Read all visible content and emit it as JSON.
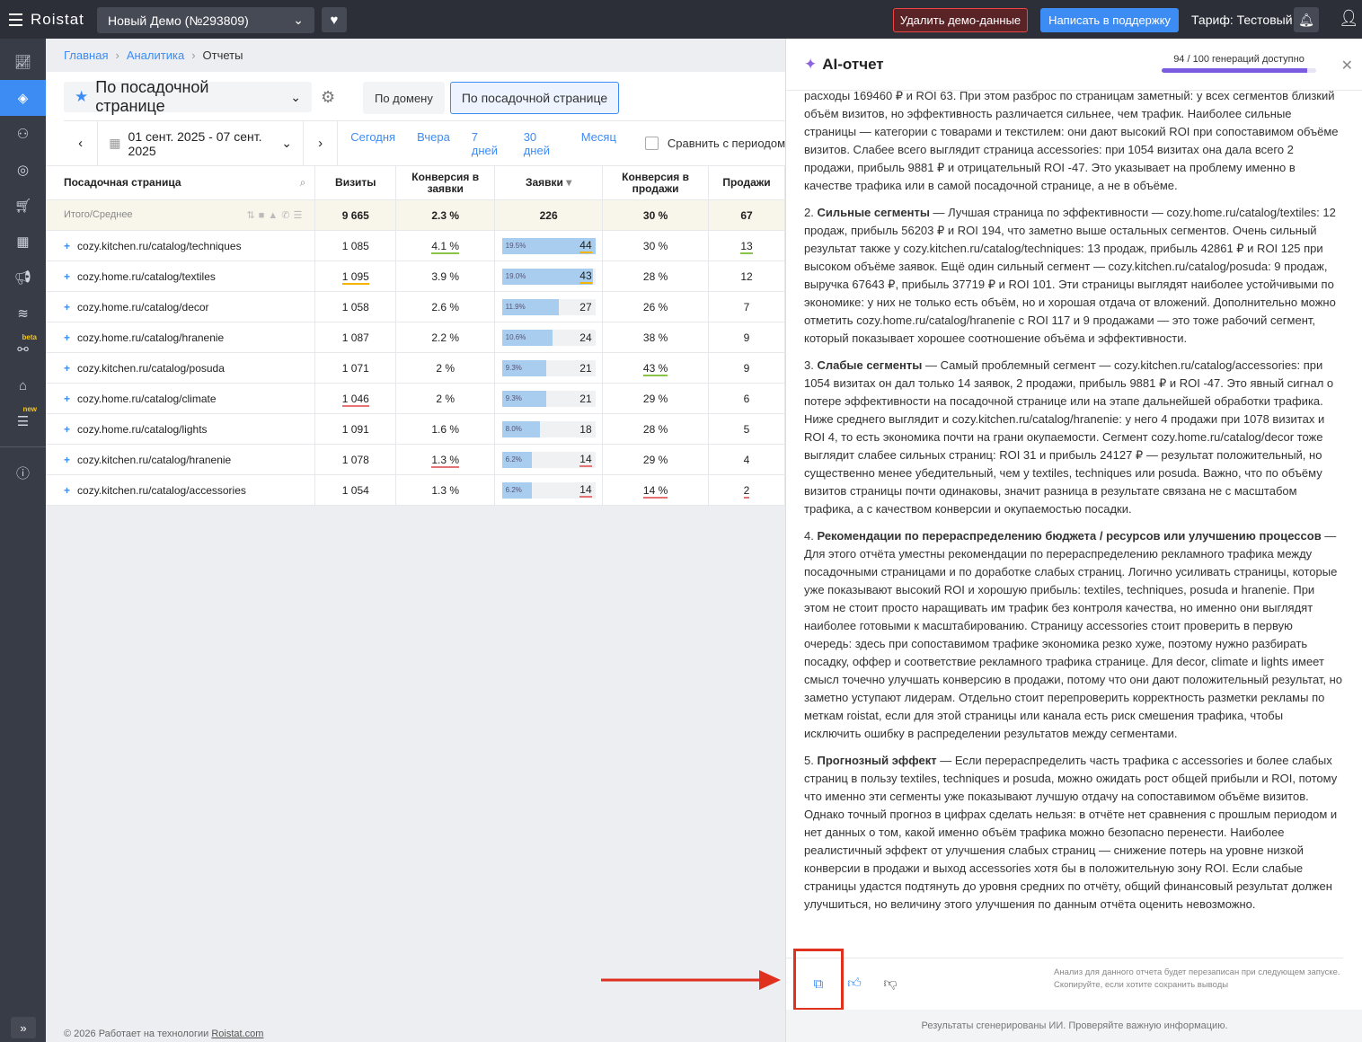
{
  "topbar": {
    "logo": "Roistat",
    "project": "Новый Демо (№293809)",
    "delete_demo": "Удалить демо-данные",
    "support": "Написать в поддержку",
    "tariff": "Тариф: Тестовый"
  },
  "sidebar": {
    "beta_tag": "beta",
    "new_tag": "new"
  },
  "breadcrumb": {
    "home": "Главная",
    "analytics": "Аналитика",
    "current": "Отчеты"
  },
  "report": {
    "title": "По посадочной странице",
    "chip_domain": "По домену",
    "chip_landing": "По посадочной странице"
  },
  "datebar": {
    "range": "01 сент. 2025 - 07 сент. 2025",
    "presets": [
      "Сегодня",
      "Вчера",
      "7 дней",
      "30 дней",
      "Месяц"
    ],
    "compare": "Сравнить с периодом"
  },
  "table": {
    "columns": [
      "Посадочная страница",
      "Визиты",
      "Конверсия в заявки",
      "Заявки",
      "Конверсия в продажи",
      "Продажи"
    ],
    "total": {
      "label": "Итого/Среднее",
      "visits": "9 665",
      "conv_leads": "2.3 %",
      "leads": "226",
      "conv_sales": "30 %",
      "sales": "67"
    },
    "rows": [
      {
        "page": "cozy.kitchen.ru/catalog/techniques",
        "visits": "1 085",
        "conv_leads": "4.1 %",
        "lead_pct": "19.5%",
        "lead_share": 19.5,
        "leads": "44",
        "conv_sales": "30 %",
        "sales": "13"
      },
      {
        "page": "cozy.home.ru/catalog/textiles",
        "visits": "1 095",
        "conv_leads": "3.9 %",
        "lead_pct": "19.0%",
        "lead_share": 19.0,
        "leads": "43",
        "conv_sales": "28 %",
        "sales": "12"
      },
      {
        "page": "cozy.home.ru/catalog/decor",
        "visits": "1 058",
        "conv_leads": "2.6 %",
        "lead_pct": "11.9%",
        "lead_share": 11.9,
        "leads": "27",
        "conv_sales": "26 %",
        "sales": "7"
      },
      {
        "page": "cozy.home.ru/catalog/hranenie",
        "visits": "1 087",
        "conv_leads": "2.2 %",
        "lead_pct": "10.6%",
        "lead_share": 10.6,
        "leads": "24",
        "conv_sales": "38 %",
        "sales": "9"
      },
      {
        "page": "cozy.kitchen.ru/catalog/posuda",
        "visits": "1 071",
        "conv_leads": "2 %",
        "lead_pct": "9.3%",
        "lead_share": 9.3,
        "leads": "21",
        "conv_sales": "43 %",
        "sales": "9"
      },
      {
        "page": "cozy.home.ru/catalog/climate",
        "visits": "1 046",
        "conv_leads": "2 %",
        "lead_pct": "9.3%",
        "lead_share": 9.3,
        "leads": "21",
        "conv_sales": "29 %",
        "sales": "6"
      },
      {
        "page": "cozy.home.ru/catalog/lights",
        "visits": "1 091",
        "conv_leads": "1.6 %",
        "lead_pct": "8.0%",
        "lead_share": 8.0,
        "leads": "18",
        "conv_sales": "28 %",
        "sales": "5"
      },
      {
        "page": "cozy.kitchen.ru/catalog/hranenie",
        "visits": "1 078",
        "conv_leads": "1.3 %",
        "lead_pct": "6.2%",
        "lead_share": 6.2,
        "leads": "14",
        "conv_sales": "29 %",
        "sales": "4"
      },
      {
        "page": "cozy.kitchen.ru/catalog/accessories",
        "visits": "1 054",
        "conv_leads": "1.3 %",
        "lead_pct": "6.2%",
        "lead_share": 6.2,
        "leads": "14",
        "conv_sales": "14 %",
        "sales": "2"
      }
    ]
  },
  "footer": {
    "text": "© 2026 Работает на технологии ",
    "link": "Roistat.com"
  },
  "ai_panel": {
    "title": "AI-отчет",
    "generations": "94 / 100 генераций доступно",
    "generations_used": 94,
    "generations_total": 100,
    "intro": "расходы 169460 ₽ и ROI 63. При этом разброс по страницам заметный: у всех сегментов близкий объём визитов, но эффективность различается сильнее, чем трафик. Наиболее сильные страницы — категории с товарами и текстилем: они дают высокий ROI при сопоставимом объёме визитов. Слабее всего выглядит страница accessories: при 1054 визитах она дала всего 2 продажи, прибыль 9881 ₽ и отрицательный ROI -47. Это указывает на проблему именно в качестве трафика или в самой посадочной странице, а не в объёме.",
    "sections": [
      {
        "num": "2. ",
        "head": "Сильные сегменты",
        "text": " — Лучшая страница по эффективности — cozy.home.ru/catalog/textiles: 12 продаж, прибыль 56203 ₽ и ROI 194, что заметно выше остальных сегментов. Очень сильный результат также у cozy.kitchen.ru/catalog/techniques: 13 продаж, прибыль 42861 ₽ и ROI 125 при высоком объёме заявок. Ещё один сильный сегмент — cozy.kitchen.ru/catalog/posuda: 9 продаж, выручка 67643 ₽, прибыль 37719 ₽ и ROI 101. Эти страницы выглядят наиболее устойчивыми по экономике: у них не только есть объём, но и хорошая отдача от вложений. Дополнительно можно отметить cozy.home.ru/catalog/hranenie с ROI 117 и 9 продажами — это тоже рабочий сегмент, который показывает хорошее соотношение объёма и эффективности."
      },
      {
        "num": "3. ",
        "head": "Слабые сегменты",
        "text": " — Самый проблемный сегмент — cozy.kitchen.ru/catalog/accessories: при 1054 визитах он дал только 14 заявок, 2 продажи, прибыль 9881 ₽ и ROI -47. Это явный сигнал о потере эффективности на посадочной странице или на этапе дальнейшей обработки трафика. Ниже среднего выглядит и cozy.kitchen.ru/catalog/hranenie: у него 4 продажи при 1078 визитах и ROI 4, то есть экономика почти на грани окупаемости. Сегмент cozy.home.ru/catalog/decor тоже выглядит слабее сильных страниц: ROI 31 и прибыль 24127 ₽ — результат положительный, но существенно менее убедительный, чем у textiles, techniques или posuda. Важно, что по объёму визитов страницы почти одинаковы, значит разница в результате связана не с масштабом трафика, а с качеством конверсии и окупаемостью посадки."
      },
      {
        "num": "4. ",
        "head": "Рекомендации по перераспределению бюджета / ресурсов или улучшению процессов",
        "text": " — Для этого отчёта уместны рекомендации по перераспределению рекламного трафика между посадочными страницами и по доработке слабых страниц. Логично усиливать страницы, которые уже показывают высокий ROI и хорошую прибыль: textiles, techniques, posuda и hranenie. При этом не стоит просто наращивать им трафик без контроля качества, но именно они выглядят наиболее готовыми к масштабированию. Страницу accessories стоит проверить в первую очередь: здесь при сопоставимом трафике экономика резко хуже, поэтому нужно разбирать посадку, оффер и соответствие рекламного трафика странице. Для decor, climate и lights имеет смысл точечно улучшать конверсию в продажи, потому что они дают положительный результат, но заметно уступают лидерам. Отдельно стоит перепроверить корректность разметки рекламы по меткам roistat, если для этой страницы или канала есть риск смешения трафика, чтобы исключить ошибку в распределении результатов между сегментами."
      },
      {
        "num": "5. ",
        "head": "Прогнозный эффект",
        "text": " — Если перераспределить часть трафика с accessories и более слабых страниц в пользу textiles, techniques и posuda, можно ожидать рост общей прибыли и ROI, потому что именно эти сегменты уже показывают лучшую отдачу на сопоставимом объёме визитов. Однако точный прогноз в цифрах сделать нельзя: в отчёте нет сравнения с прошлым периодом и нет данных о том, какой именно объём трафика можно безопасно перенести. Наиболее реалистичный эффект от улучшения слабых страниц — снижение потерь на уровне низкой конверсии в продажи и выход accessories хотя бы в положительную зону ROI. Если слабые страницы удастся подтянуть до уровня средних по отчёту, общий финансовый результат должен улучшиться, но величину этого улучшения по данным отчёта оценить невозможно."
      }
    ],
    "note": "Анализ для данного отчета будет перезаписан при следующем запуске. Скопируйте, если хотите сохранить выводы",
    "disclaimer": "Результаты сгенерированы ИИ. Проверяйте важную информацию."
  }
}
